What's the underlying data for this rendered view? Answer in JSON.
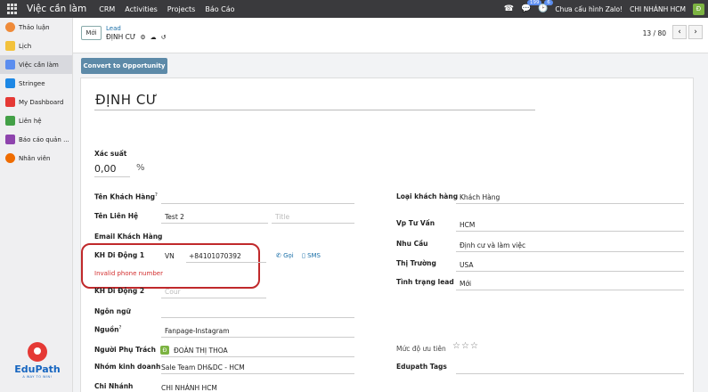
{
  "topbar": {
    "app_title": "Việc cần làm",
    "nav": [
      "CRM",
      "Activities",
      "Projects",
      "Báo Cáo"
    ],
    "chat_badge": "199",
    "activity_badge": "6",
    "zalo_text": "Chưa cấu hình Zalo!",
    "company": "CHI NHÁNH HCM",
    "user_initial": "Đ"
  },
  "sidebar": {
    "items": [
      {
        "label": "Thảo luận",
        "color": "#ef8b3a"
      },
      {
        "label": "Lịch",
        "color": "#f3c23c"
      },
      {
        "label": "Việc cần làm",
        "color": "#5b8def"
      },
      {
        "label": "Stringee",
        "color": "#1e88e5"
      },
      {
        "label": "My Dashboard",
        "color": "#e53935"
      },
      {
        "label": "Liên hệ",
        "color": "#43a047"
      },
      {
        "label": "Báo cáo quản ...",
        "color": "#8e44ad"
      },
      {
        "label": "Nhân viên",
        "color": "#ef6c00"
      }
    ],
    "logo_name": "EduPath",
    "logo_tag": "A WAY TO WIN!"
  },
  "control": {
    "new_label": "Mới",
    "breadcrumb_parent": "Lead",
    "record_name": "ĐỊNH CƯ",
    "pager": "13 / 80"
  },
  "form": {
    "convert_label": "Convert to Opportunity",
    "name": "ĐỊNH CƯ",
    "probability_label": "Xác suất",
    "probability_value": "0,00",
    "probability_unit": "%",
    "customer_name_label": "Tên Khách Hàng",
    "contact_name_label": "Tên Liên Hệ",
    "contact_name_value": "Test 2",
    "title_placeholder": "Title",
    "email_label": "Email Khách Hàng",
    "mobile1_label": "KH Di Động 1",
    "mobile1_country": "VN",
    "mobile1_value": "+84101070392",
    "call_label": "Gọi",
    "sms_label": "SMS",
    "mobile_error": "Invalid phone number",
    "mobile2_label": "KH Di Động 2",
    "mobile2_placeholder": "Cour",
    "language_label": "Ngôn ngữ",
    "source_label": "Nguồn",
    "source_value": "Fanpage-Instagram",
    "owner_label": "Người Phụ Trách",
    "owner_initial": "Đ",
    "owner_value": "ĐOÀN THỊ THOA",
    "team_label": "Nhóm kinh doanh",
    "team_value": "Sale Team DH&DC - HCM",
    "branch_label": "Chi Nhánh",
    "branch_value": "CHI NHÁNH HCM",
    "customer_type_label": "Loại khách hàng",
    "customer_type_value": "Khách Hàng",
    "consultant_label": "Vp Tư Vấn",
    "consultant_value": "HCM",
    "need_label": "Nhu Cầu",
    "need_value": "Định cư và làm việc",
    "market_label": "Thị Trường",
    "market_value": "USA",
    "lead_status_label": "Tình trạng lead",
    "lead_status_value": "Mới",
    "priority_label": "Mức độ ưu tiên",
    "tags_label": "Edupath Tags"
  }
}
